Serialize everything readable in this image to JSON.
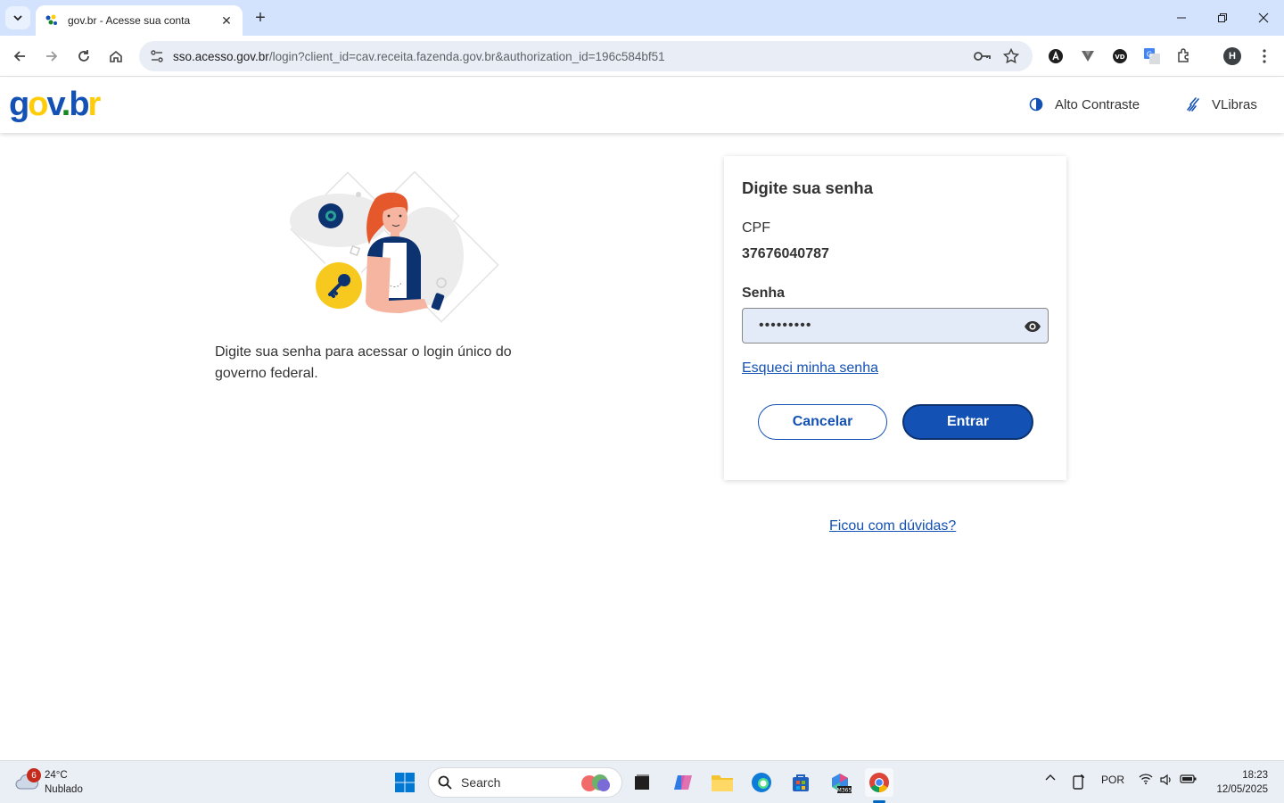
{
  "browser": {
    "tab_title": "gov.br - Acesse sua conta",
    "url_host": "sso.acesso.gov.br",
    "url_rest": "/login?client_id=cav.receita.fazenda.gov.br&authorization_id=196c584bf51",
    "profile_initial": "H"
  },
  "header": {
    "logo_parts": [
      "g",
      "o",
      "v",
      ".",
      "b",
      "r"
    ],
    "high_contrast": "Alto Contraste",
    "vlibras": "VLibras"
  },
  "intro": {
    "text": "Digite sua senha para acessar o login único do governo federal."
  },
  "login": {
    "title": "Digite sua senha",
    "cpf_label": "CPF",
    "cpf_value": "37676040787",
    "password_label": "Senha",
    "password_value": "•••••••••",
    "forgot_link": "Esqueci minha senha",
    "cancel_label": "Cancelar",
    "enter_label": "Entrar"
  },
  "help_link": "Ficou com dúvidas?",
  "taskbar": {
    "weather_badge": "6",
    "weather_temp": "24°C",
    "weather_desc": "Nublado",
    "search_label": "Search",
    "language": "POR",
    "time": "18:23",
    "date": "12/05/2025"
  },
  "colors": {
    "primary": "#1351b4",
    "primary_dark": "#0c326f",
    "yellow": "#ffcd07",
    "green": "#168821",
    "input_bg": "#e3ebf8"
  }
}
